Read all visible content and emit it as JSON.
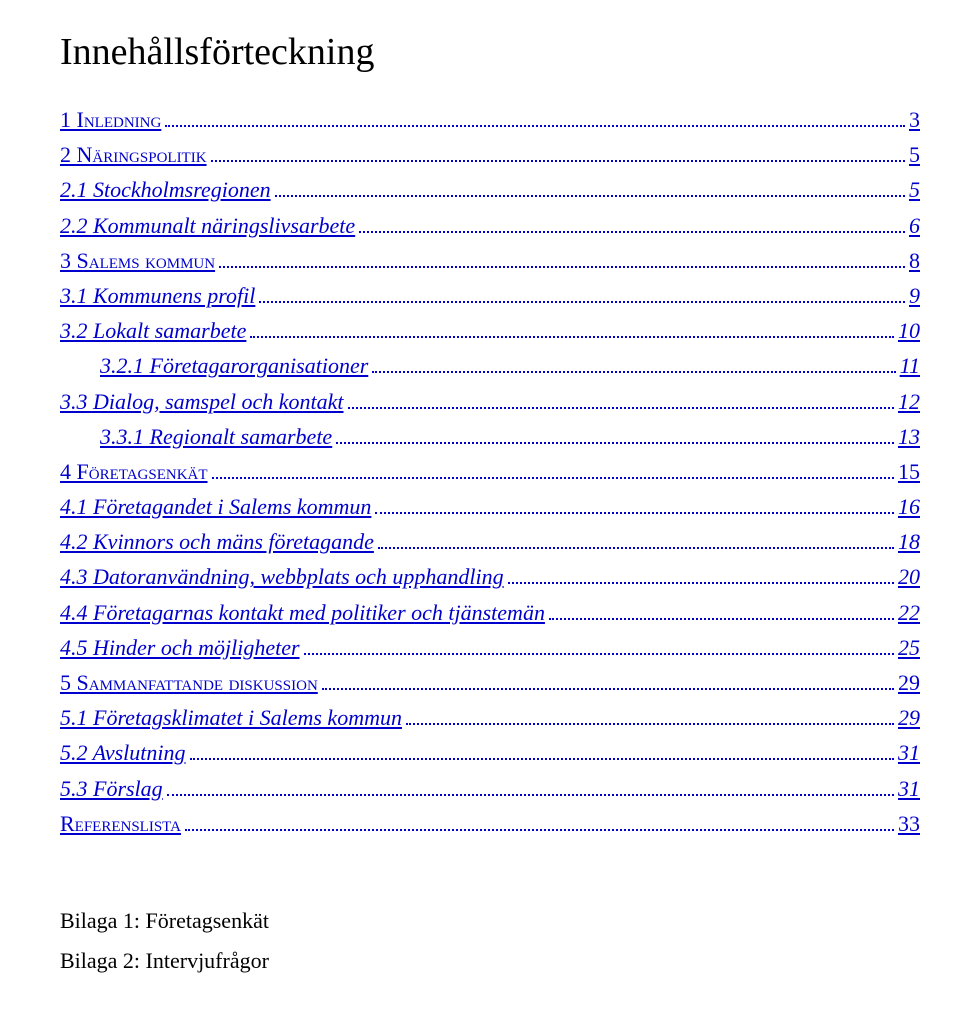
{
  "title": "Innehållsförteckning",
  "toc": [
    {
      "label": "1 Inledning",
      "page": "3",
      "level": 0,
      "smallcaps": true
    },
    {
      "label": "2 Näringspolitik",
      "page": "5",
      "level": 0,
      "smallcaps": true
    },
    {
      "label": "2.1 Stockholmsregionen",
      "page": "5",
      "level": 1
    },
    {
      "label": "2.2 Kommunalt näringslivsarbete",
      "page": "6",
      "level": 1
    },
    {
      "label": "3 Salems kommun",
      "page": "8",
      "level": 0,
      "smallcaps": true
    },
    {
      "label": "3.1 Kommunens profil",
      "page": "9",
      "level": 1
    },
    {
      "label": "3.2 Lokalt samarbete",
      "page": "10",
      "level": 1
    },
    {
      "label": "3.2.1 Företagarorganisationer",
      "page": "11",
      "level": 2
    },
    {
      "label": "3.3 Dialog, samspel och kontakt",
      "page": "12",
      "level": 1
    },
    {
      "label": "3.3.1 Regionalt samarbete",
      "page": "13",
      "level": 2
    },
    {
      "label": "4 Företagsenkät",
      "page": "15",
      "level": 0,
      "smallcaps": true
    },
    {
      "label": "4.1 Företagandet i Salems kommun",
      "page": "16",
      "level": 1
    },
    {
      "label": "4.2 Kvinnors och mäns företagande",
      "page": "18",
      "level": 1
    },
    {
      "label": "4.3 Datoranvändning, webbplats och upphandling",
      "page": "20",
      "level": 1
    },
    {
      "label": "4.4 Företagarnas kontakt med politiker och tjänstemän",
      "page": "22",
      "level": 1
    },
    {
      "label": "4.5 Hinder och möjligheter",
      "page": "25",
      "level": 1
    },
    {
      "label": "5 Sammanfattande diskussion",
      "page": "29",
      "level": 0,
      "smallcaps": true
    },
    {
      "label": "5.1 Företagsklimatet i Salems kommun",
      "page": "29",
      "level": 1
    },
    {
      "label": "5.2 Avslutning",
      "page": "31",
      "level": 1
    },
    {
      "label": "5.3 Förslag",
      "page": "31",
      "level": 1
    },
    {
      "label": "Referenslista",
      "page": "33",
      "level": 0,
      "smallcaps": true
    }
  ],
  "appendix": [
    "Bilaga 1: Företagsenkät",
    "Bilaga 2: Intervjufrågor"
  ]
}
